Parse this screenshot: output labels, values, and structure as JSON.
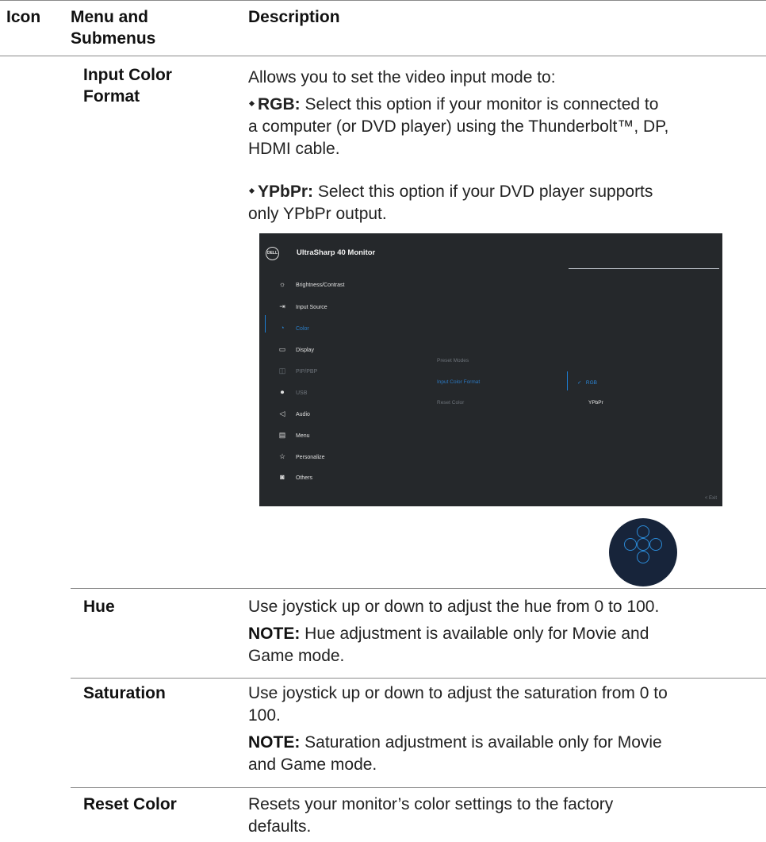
{
  "header": {
    "col_icon": "Icon",
    "col_menu": "Menu and Submenus",
    "col_desc": "Description"
  },
  "input_color_format": {
    "name_line1": "Input Color",
    "name_line2": "Format",
    "intro": "Allows you to set the video input mode to:",
    "rgb_label": "RGB:",
    "rgb_l1": "Select this option if your monitor is connected to",
    "rgb_l2": "a computer (or DVD player) using the Thunderbolt™, DP,",
    "rgb_l3": "HDMI cable.",
    "ypbpr_label": "YPbPr:",
    "ypbpr_l1": "Select this option if your DVD player supports",
    "ypbpr_l2": "only YPbPr output."
  },
  "osd": {
    "logo": "DELL",
    "title": "UltraSharp 40 Monitor",
    "menu": [
      {
        "label": "Brightness/Contrast",
        "icon": "☼"
      },
      {
        "label": "Input Source",
        "icon": "⇥"
      },
      {
        "label": "Color",
        "icon": "◔"
      },
      {
        "label": "Display",
        "icon": "▭"
      },
      {
        "label": "PIP/PBP",
        "icon": "◫"
      },
      {
        "label": "USB",
        "icon": "⏺"
      },
      {
        "label": "Audio",
        "icon": "◁"
      },
      {
        "label": "Menu",
        "icon": "▤"
      },
      {
        "label": "Personalize",
        "icon": "☆"
      },
      {
        "label": "Others",
        "icon": "◙"
      }
    ],
    "submenu": [
      "Preset Modes",
      "Input Color Format",
      "Reset Color"
    ],
    "options": [
      "RGB",
      "YPbPr"
    ],
    "check": "✓",
    "exit": "<  Exit",
    "colors": {
      "background": "#25282b",
      "accent": "#1c7fd6"
    }
  },
  "joystick": {
    "icon": "joystick-icon"
  },
  "hue": {
    "name": "Hue",
    "desc": "Use joystick up or down to adjust the hue from 0 to 100.",
    "note_label": "NOTE:",
    "note_l1": "Hue adjustment is available only for Movie and",
    "note_l2": "Game mode."
  },
  "saturation": {
    "name": "Saturation",
    "desc_l1": "Use joystick up or down to adjust the saturation from 0 to",
    "desc_l2": "100.",
    "note_label": "NOTE:",
    "note_l1": "Saturation adjustment is available only for Movie",
    "note_l2": "and Game mode."
  },
  "reset_color": {
    "name": "Reset Color",
    "desc_l1": "Resets your monitor’s color settings to the factory",
    "desc_l2": "defaults."
  }
}
